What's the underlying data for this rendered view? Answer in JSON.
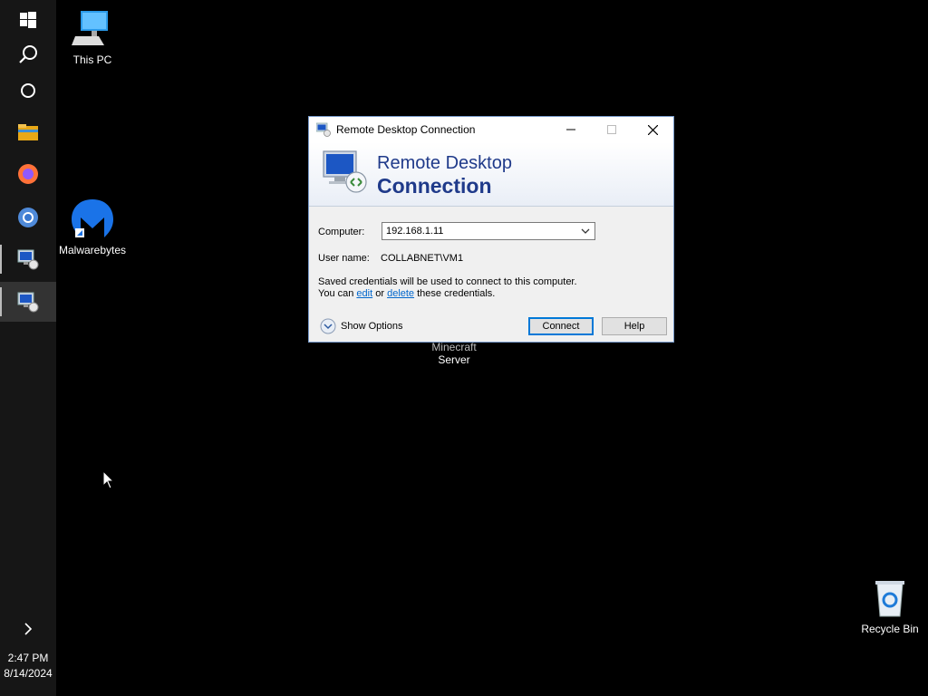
{
  "taskbar": {
    "items": [
      {
        "name": "start-button",
        "icon": "windows-logo-icon"
      },
      {
        "name": "search-button",
        "icon": "search-icon"
      },
      {
        "name": "cortana-button",
        "icon": "cortana-icon"
      },
      {
        "name": "file-explorer-button",
        "icon": "folder-icon"
      },
      {
        "name": "firefox-button",
        "icon": "firefox-icon"
      },
      {
        "name": "chrome-button",
        "icon": "chrome-icon"
      },
      {
        "name": "rdp-taskbar-button-1",
        "icon": "remote-desktop-icon"
      },
      {
        "name": "rdp-taskbar-button-2",
        "icon": "remote-desktop-icon"
      }
    ],
    "clock_time": "2:47 PM",
    "clock_date": "8/14/2024"
  },
  "desktop": {
    "this_pc": "This PC",
    "malwarebytes": "Malwarebytes",
    "minecraft_line1": "Minecraft",
    "minecraft_line2": "Server",
    "recycle_bin": "Recycle Bin"
  },
  "dialog": {
    "title": "Remote Desktop Connection",
    "banner_line1": "Remote Desktop",
    "banner_line2": "Connection",
    "computer_label": "Computer:",
    "computer_value": "192.168.1.11",
    "username_label": "User name:",
    "username_value": "COLLABNET\\VM1",
    "saved_line1": "Saved credentials will be used to connect to this computer.",
    "saved_prefix": "You can",
    "edit_link": "edit",
    "or_text": "or",
    "delete_link": "delete",
    "saved_suffix": "these credentials.",
    "show_options": "Show Options",
    "connect_button": "Connect",
    "help_button": "Help"
  },
  "colors": {
    "accent": "#0078d7",
    "banner_text": "#1f3a8a",
    "link": "#0066cc"
  }
}
